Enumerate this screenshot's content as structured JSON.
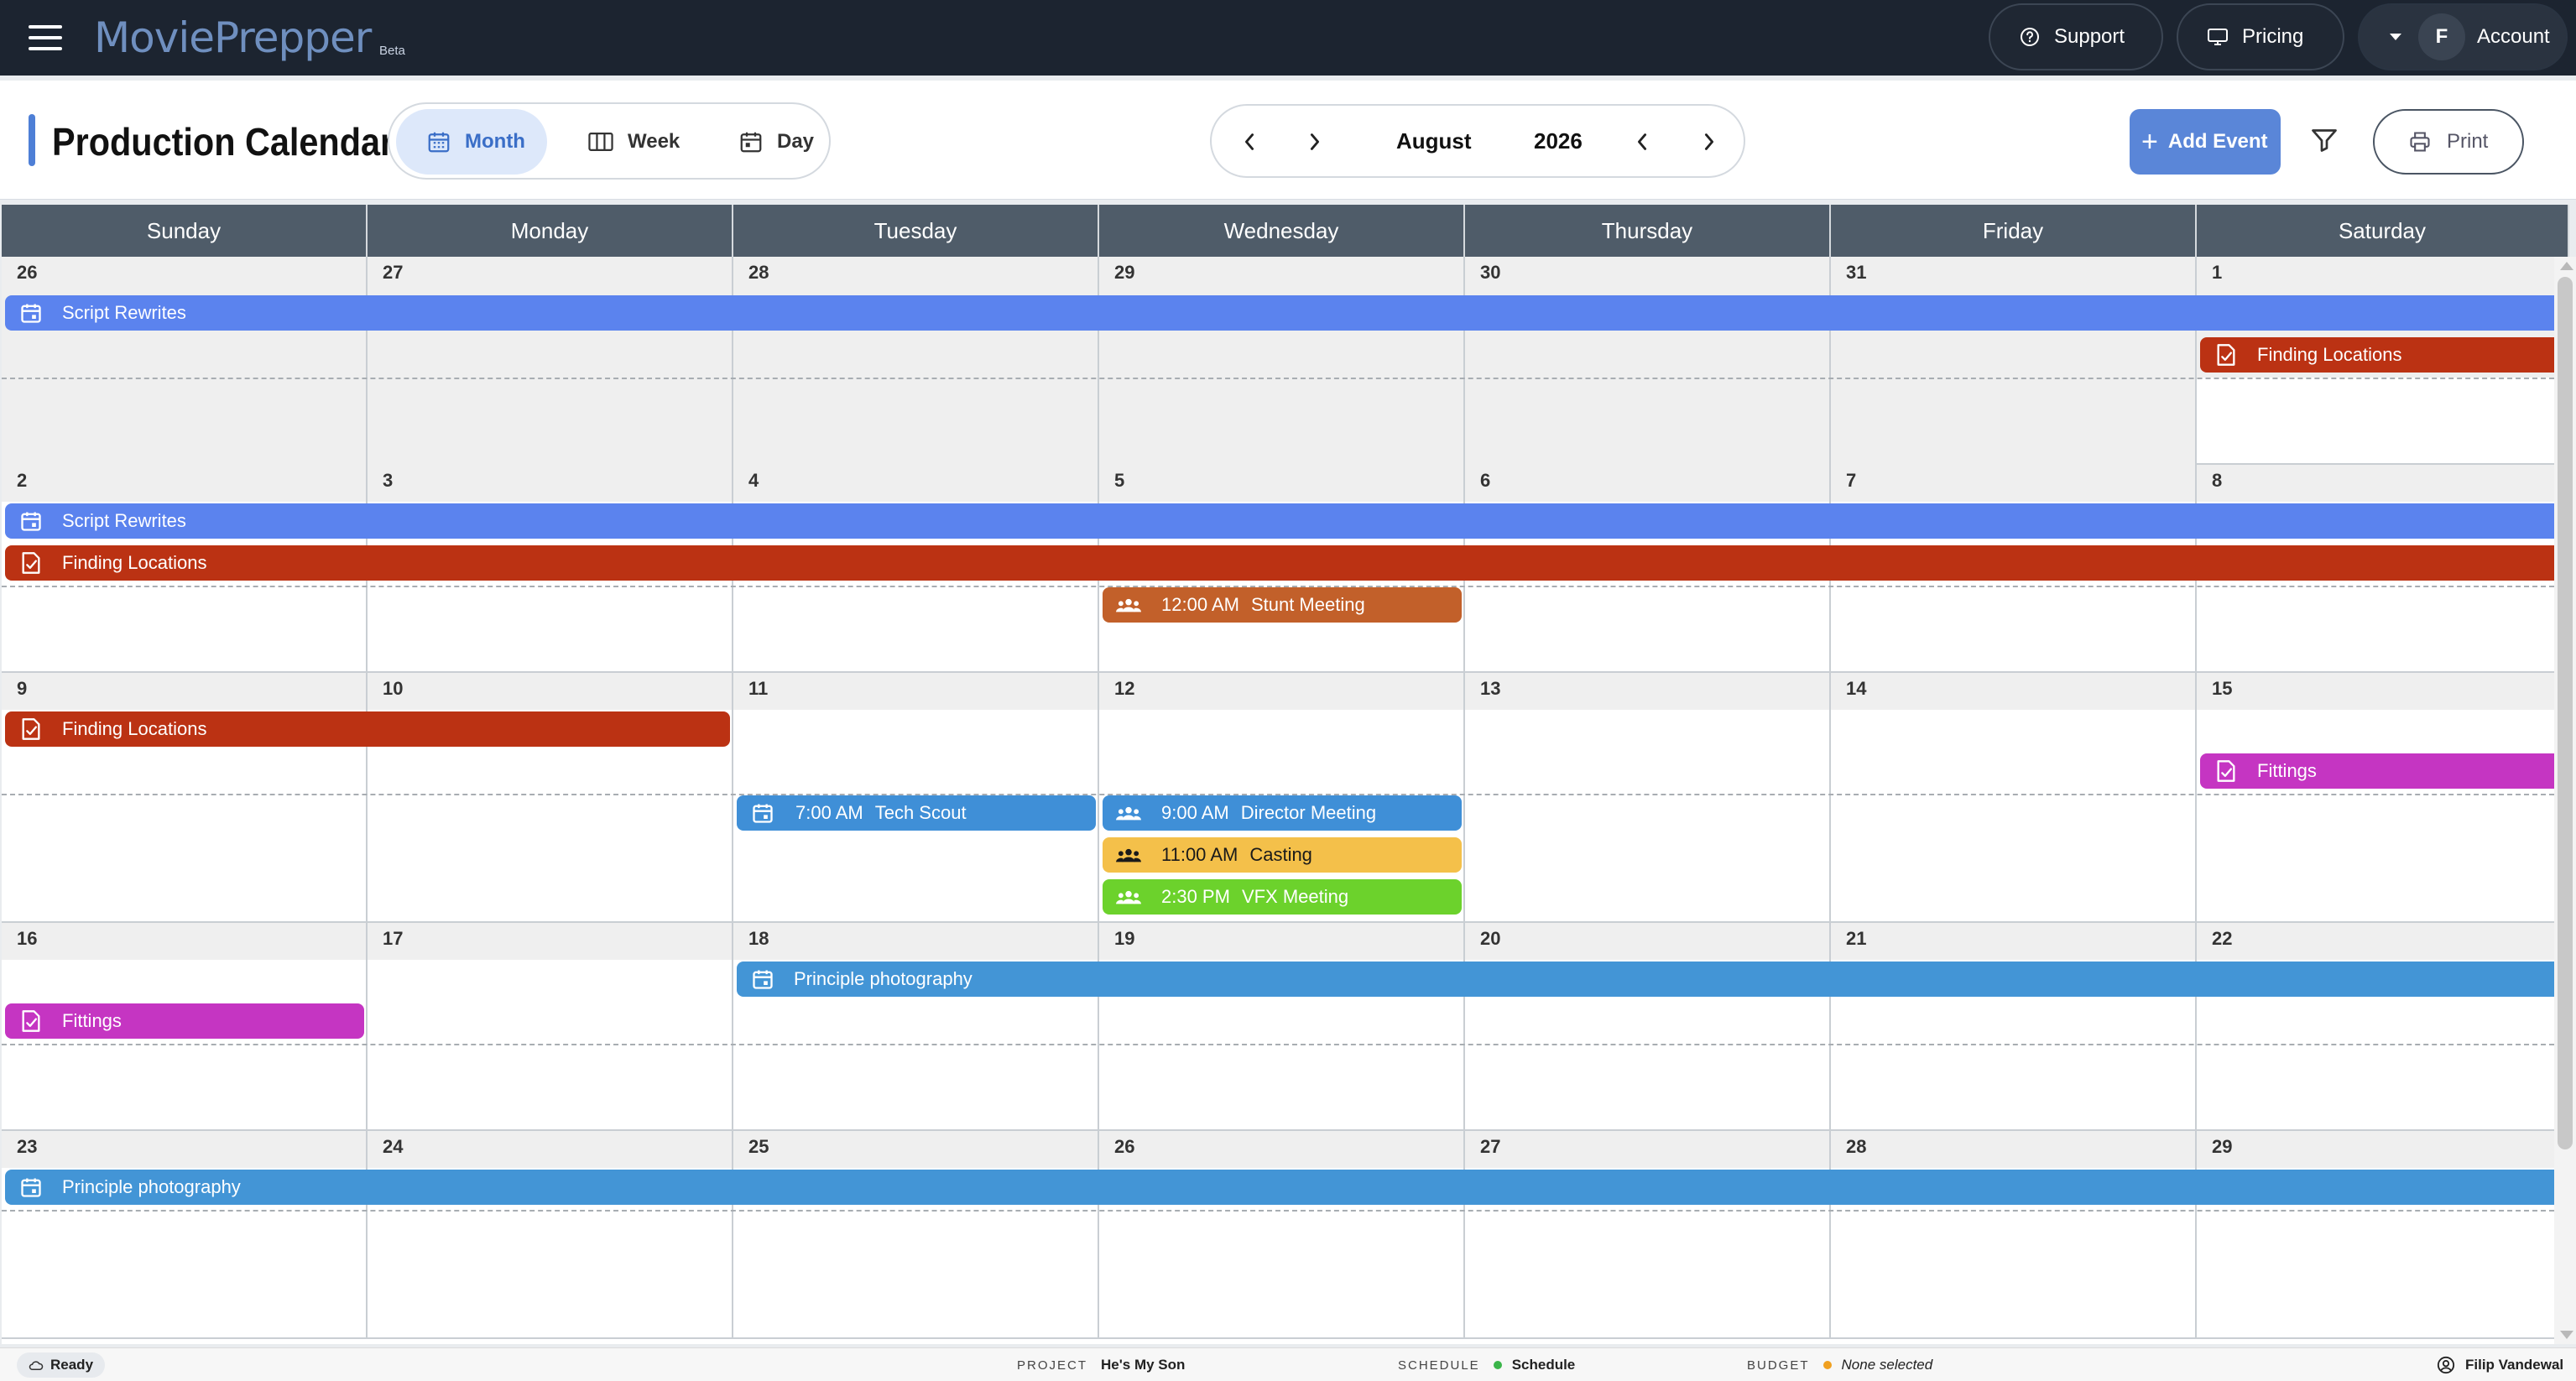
{
  "app": {
    "name": "MoviePrepper",
    "beta_label": "Beta",
    "nav": {
      "support": "Support",
      "pricing": "Pricing",
      "account": "Account",
      "avatar_initial": "F"
    }
  },
  "toolbar": {
    "title": "Production Calendar",
    "views": {
      "month": "Month",
      "week": "Week",
      "day": "Day",
      "active": "Month"
    },
    "month": "August",
    "year": "2026",
    "add_event": "Add Event",
    "print": "Print"
  },
  "calendar": {
    "weekdays": [
      "Sunday",
      "Monday",
      "Tuesday",
      "Wednesday",
      "Thursday",
      "Friday",
      "Saturday"
    ],
    "weeks": [
      {
        "days": [
          "26",
          "27",
          "28",
          "29",
          "30",
          "31",
          "1"
        ]
      },
      {
        "days": [
          "2",
          "3",
          "4",
          "5",
          "6",
          "7",
          "8"
        ]
      },
      {
        "days": [
          "9",
          "10",
          "11",
          "12",
          "13",
          "14",
          "15"
        ]
      },
      {
        "days": [
          "16",
          "17",
          "18",
          "19",
          "20",
          "21",
          "22"
        ]
      },
      {
        "days": [
          "23",
          "24",
          "25",
          "26",
          "27",
          "28",
          "29"
        ]
      }
    ],
    "events": [
      {
        "week": 0,
        "title": "Script Rewrites",
        "time": "",
        "icon": "calendar-icon",
        "color": "#5b83ee"
      },
      {
        "week": 0,
        "title": "Finding Locations",
        "time": "",
        "icon": "task-check-icon",
        "color": "#bb3213"
      },
      {
        "week": 1,
        "title": "Script Rewrites",
        "time": "",
        "icon": "calendar-icon",
        "color": "#5b83ee"
      },
      {
        "week": 1,
        "title": "Finding Locations",
        "time": "",
        "icon": "task-check-icon",
        "color": "#bb3213"
      },
      {
        "week": 1,
        "title": "Stunt Meeting",
        "time": "12:00 AM",
        "icon": "people-icon",
        "color": "#c2602a"
      },
      {
        "week": 2,
        "title": "Finding Locations",
        "time": "",
        "icon": "task-check-icon",
        "color": "#bb3213"
      },
      {
        "week": 2,
        "title": "Fittings",
        "time": "",
        "icon": "task-check-icon",
        "color": "#c535c2"
      },
      {
        "week": 2,
        "title": "Tech Scout",
        "time": "7:00 AM",
        "icon": "calendar-icon",
        "color": "#3f8fd7"
      },
      {
        "week": 2,
        "title": "Director Meeting",
        "time": "9:00 AM",
        "icon": "people-icon",
        "color": "#3f8fd7"
      },
      {
        "week": 2,
        "title": "Casting",
        "time": "11:00 AM",
        "icon": "people-icon",
        "color": "#f4c04a"
      },
      {
        "week": 2,
        "title": "VFX Meeting",
        "time": "2:30 PM",
        "icon": "people-icon",
        "color": "#6cd22c"
      },
      {
        "week": 3,
        "title": "Fittings",
        "time": "",
        "icon": "task-check-icon",
        "color": "#c535c2"
      },
      {
        "week": 3,
        "title": "Principle photography",
        "time": "",
        "icon": "calendar-icon",
        "color": "#4395d6"
      },
      {
        "week": 4,
        "title": "Principle photography",
        "time": "",
        "icon": "calendar-icon",
        "color": "#4395d6"
      }
    ]
  },
  "statusbar": {
    "ready": "Ready",
    "project_label": "PROJECT",
    "project_value": "He's My Son",
    "schedule_label": "SCHEDULE",
    "schedule_value": "Schedule",
    "budget_label": "BUDGET",
    "budget_value": "None selected",
    "user": "Filip Vandewal",
    "colors": {
      "schedule_dot": "#3bb54a",
      "budget_dot": "#f0a020"
    }
  }
}
